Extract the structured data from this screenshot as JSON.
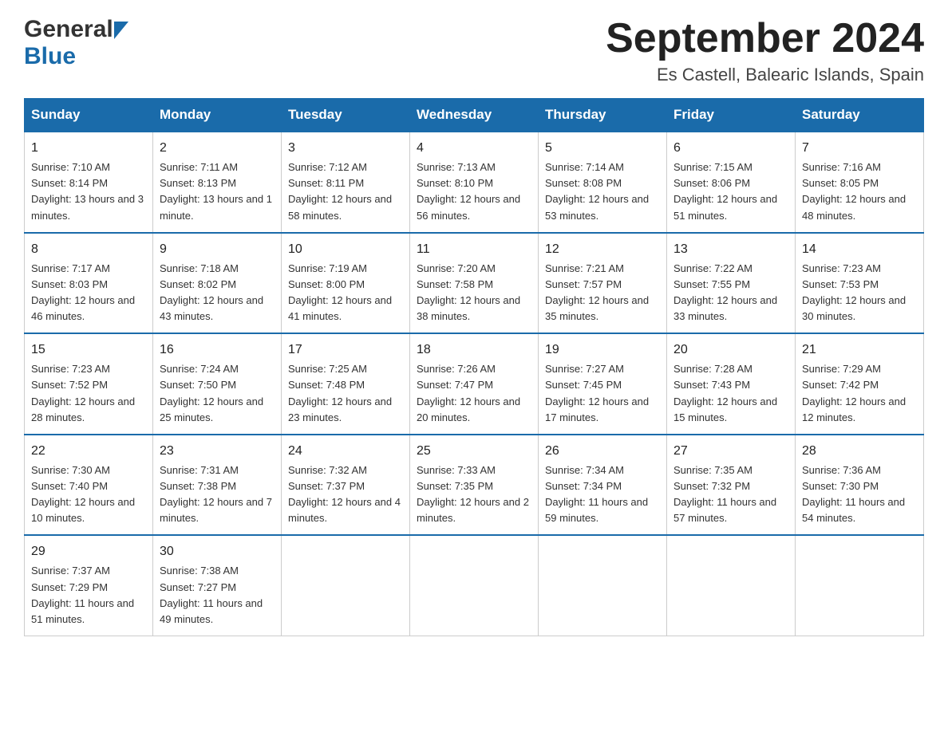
{
  "header": {
    "title": "September 2024",
    "location": "Es Castell, Balearic Islands, Spain",
    "logo_general": "General",
    "logo_blue": "Blue"
  },
  "days_of_week": [
    "Sunday",
    "Monday",
    "Tuesday",
    "Wednesday",
    "Thursday",
    "Friday",
    "Saturday"
  ],
  "weeks": [
    [
      {
        "day": "1",
        "sunrise": "7:10 AM",
        "sunset": "8:14 PM",
        "daylight": "13 hours and 3 minutes."
      },
      {
        "day": "2",
        "sunrise": "7:11 AM",
        "sunset": "8:13 PM",
        "daylight": "13 hours and 1 minute."
      },
      {
        "day": "3",
        "sunrise": "7:12 AM",
        "sunset": "8:11 PM",
        "daylight": "12 hours and 58 minutes."
      },
      {
        "day": "4",
        "sunrise": "7:13 AM",
        "sunset": "8:10 PM",
        "daylight": "12 hours and 56 minutes."
      },
      {
        "day": "5",
        "sunrise": "7:14 AM",
        "sunset": "8:08 PM",
        "daylight": "12 hours and 53 minutes."
      },
      {
        "day": "6",
        "sunrise": "7:15 AM",
        "sunset": "8:06 PM",
        "daylight": "12 hours and 51 minutes."
      },
      {
        "day": "7",
        "sunrise": "7:16 AM",
        "sunset": "8:05 PM",
        "daylight": "12 hours and 48 minutes."
      }
    ],
    [
      {
        "day": "8",
        "sunrise": "7:17 AM",
        "sunset": "8:03 PM",
        "daylight": "12 hours and 46 minutes."
      },
      {
        "day": "9",
        "sunrise": "7:18 AM",
        "sunset": "8:02 PM",
        "daylight": "12 hours and 43 minutes."
      },
      {
        "day": "10",
        "sunrise": "7:19 AM",
        "sunset": "8:00 PM",
        "daylight": "12 hours and 41 minutes."
      },
      {
        "day": "11",
        "sunrise": "7:20 AM",
        "sunset": "7:58 PM",
        "daylight": "12 hours and 38 minutes."
      },
      {
        "day": "12",
        "sunrise": "7:21 AM",
        "sunset": "7:57 PM",
        "daylight": "12 hours and 35 minutes."
      },
      {
        "day": "13",
        "sunrise": "7:22 AM",
        "sunset": "7:55 PM",
        "daylight": "12 hours and 33 minutes."
      },
      {
        "day": "14",
        "sunrise": "7:23 AM",
        "sunset": "7:53 PM",
        "daylight": "12 hours and 30 minutes."
      }
    ],
    [
      {
        "day": "15",
        "sunrise": "7:23 AM",
        "sunset": "7:52 PM",
        "daylight": "12 hours and 28 minutes."
      },
      {
        "day": "16",
        "sunrise": "7:24 AM",
        "sunset": "7:50 PM",
        "daylight": "12 hours and 25 minutes."
      },
      {
        "day": "17",
        "sunrise": "7:25 AM",
        "sunset": "7:48 PM",
        "daylight": "12 hours and 23 minutes."
      },
      {
        "day": "18",
        "sunrise": "7:26 AM",
        "sunset": "7:47 PM",
        "daylight": "12 hours and 20 minutes."
      },
      {
        "day": "19",
        "sunrise": "7:27 AM",
        "sunset": "7:45 PM",
        "daylight": "12 hours and 17 minutes."
      },
      {
        "day": "20",
        "sunrise": "7:28 AM",
        "sunset": "7:43 PM",
        "daylight": "12 hours and 15 minutes."
      },
      {
        "day": "21",
        "sunrise": "7:29 AM",
        "sunset": "7:42 PM",
        "daylight": "12 hours and 12 minutes."
      }
    ],
    [
      {
        "day": "22",
        "sunrise": "7:30 AM",
        "sunset": "7:40 PM",
        "daylight": "12 hours and 10 minutes."
      },
      {
        "day": "23",
        "sunrise": "7:31 AM",
        "sunset": "7:38 PM",
        "daylight": "12 hours and 7 minutes."
      },
      {
        "day": "24",
        "sunrise": "7:32 AM",
        "sunset": "7:37 PM",
        "daylight": "12 hours and 4 minutes."
      },
      {
        "day": "25",
        "sunrise": "7:33 AM",
        "sunset": "7:35 PM",
        "daylight": "12 hours and 2 minutes."
      },
      {
        "day": "26",
        "sunrise": "7:34 AM",
        "sunset": "7:34 PM",
        "daylight": "11 hours and 59 minutes."
      },
      {
        "day": "27",
        "sunrise": "7:35 AM",
        "sunset": "7:32 PM",
        "daylight": "11 hours and 57 minutes."
      },
      {
        "day": "28",
        "sunrise": "7:36 AM",
        "sunset": "7:30 PM",
        "daylight": "11 hours and 54 minutes."
      }
    ],
    [
      {
        "day": "29",
        "sunrise": "7:37 AM",
        "sunset": "7:29 PM",
        "daylight": "11 hours and 51 minutes."
      },
      {
        "day": "30",
        "sunrise": "7:38 AM",
        "sunset": "7:27 PM",
        "daylight": "11 hours and 49 minutes."
      },
      null,
      null,
      null,
      null,
      null
    ]
  ]
}
